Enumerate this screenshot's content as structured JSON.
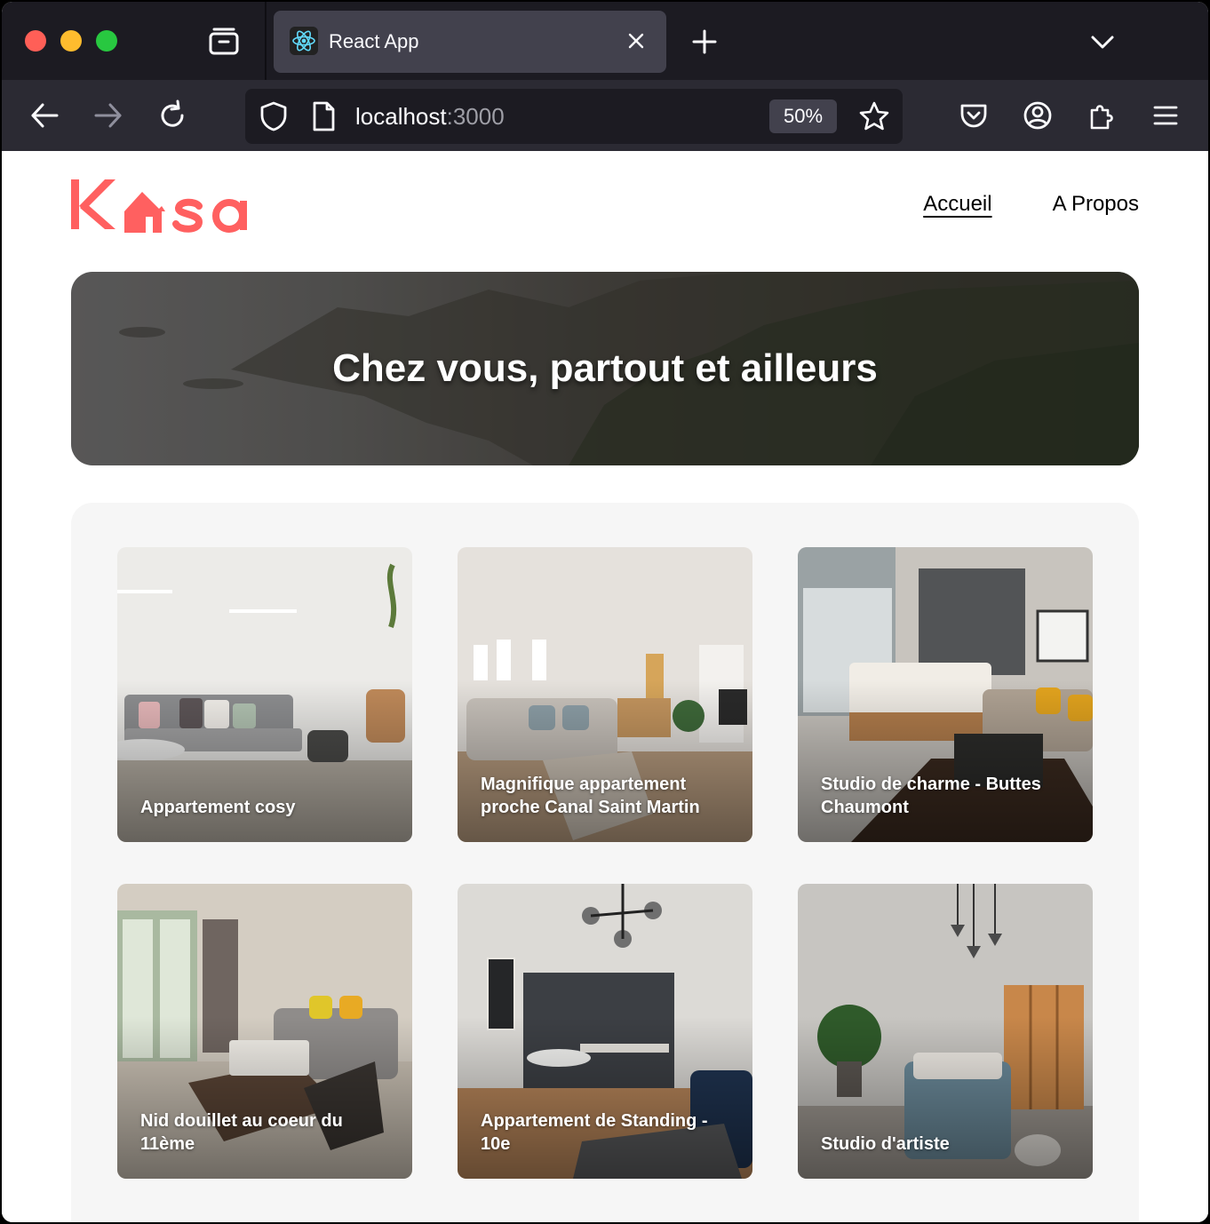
{
  "browser": {
    "tab_title": "React App",
    "url_host": "localhost",
    "url_port": ":3000",
    "zoom_level": "50%",
    "icons": [
      "tab-overview-icon",
      "react-favicon-icon",
      "close-icon",
      "plus-icon",
      "chevron-down-icon",
      "back-arrow-icon",
      "forward-arrow-icon",
      "reload-icon",
      "shield-icon",
      "page-icon",
      "star-icon",
      "pocket-icon",
      "account-icon",
      "extensions-icon",
      "menu-icon"
    ]
  },
  "site": {
    "logo_text": "Kasa",
    "brand_color": "#ff6060",
    "nav": [
      {
        "label": "Accueil",
        "active": true
      },
      {
        "label": "A Propos",
        "active": false
      }
    ],
    "banner_title": "Chez vous, partout et ailleurs",
    "listings": [
      {
        "title": "Appartement cosy"
      },
      {
        "title": "Magnifique appartement proche Canal Saint Martin"
      },
      {
        "title": "Studio de charme - Buttes Chaumont"
      },
      {
        "title": "Nid douillet au coeur du 11ème"
      },
      {
        "title": "Appartement de Standing - 10e"
      },
      {
        "title": "Studio d'artiste"
      }
    ]
  }
}
